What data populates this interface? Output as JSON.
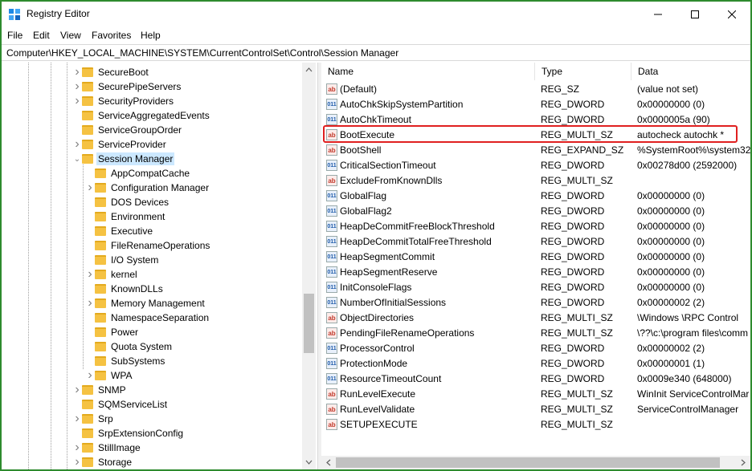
{
  "window": {
    "title": "Registry Editor"
  },
  "menu": [
    "File",
    "Edit",
    "View",
    "Favorites",
    "Help"
  ],
  "address": "Computer\\HKEY_LOCAL_MACHINE\\SYSTEM\\CurrentControlSet\\Control\\Session Manager",
  "tree": {
    "items": [
      {
        "label": "SecureBoot",
        "level": 1,
        "chev": ">"
      },
      {
        "label": "SecurePipeServers",
        "level": 1,
        "chev": ">"
      },
      {
        "label": "SecurityProviders",
        "level": 1,
        "chev": ">"
      },
      {
        "label": "ServiceAggregatedEvents",
        "level": 1,
        "chev": ""
      },
      {
        "label": "ServiceGroupOrder",
        "level": 1,
        "chev": ""
      },
      {
        "label": "ServiceProvider",
        "level": 1,
        "chev": ">"
      },
      {
        "label": "Session Manager",
        "level": 1,
        "chev": "v",
        "selected": true
      },
      {
        "label": "AppCompatCache",
        "level": 2,
        "chev": ""
      },
      {
        "label": "Configuration Manager",
        "level": 2,
        "chev": ">"
      },
      {
        "label": "DOS Devices",
        "level": 2,
        "chev": ""
      },
      {
        "label": "Environment",
        "level": 2,
        "chev": ""
      },
      {
        "label": "Executive",
        "level": 2,
        "chev": ""
      },
      {
        "label": "FileRenameOperations",
        "level": 2,
        "chev": ""
      },
      {
        "label": "I/O System",
        "level": 2,
        "chev": ""
      },
      {
        "label": "kernel",
        "level": 2,
        "chev": ">"
      },
      {
        "label": "KnownDLLs",
        "level": 2,
        "chev": ""
      },
      {
        "label": "Memory Management",
        "level": 2,
        "chev": ">"
      },
      {
        "label": "NamespaceSeparation",
        "level": 2,
        "chev": ""
      },
      {
        "label": "Power",
        "level": 2,
        "chev": ""
      },
      {
        "label": "Quota System",
        "level": 2,
        "chev": ""
      },
      {
        "label": "SubSystems",
        "level": 2,
        "chev": ""
      },
      {
        "label": "WPA",
        "level": 2,
        "chev": ">"
      },
      {
        "label": "SNMP",
        "level": 1,
        "chev": ">"
      },
      {
        "label": "SQMServiceList",
        "level": 1,
        "chev": ""
      },
      {
        "label": "Srp",
        "level": 1,
        "chev": ">"
      },
      {
        "label": "SrpExtensionConfig",
        "level": 1,
        "chev": ""
      },
      {
        "label": "StillImage",
        "level": 1,
        "chev": ">"
      },
      {
        "label": "Storage",
        "level": 1,
        "chev": ">"
      }
    ]
  },
  "columns": {
    "name": "Name",
    "type": "Type",
    "data": "Data"
  },
  "values": [
    {
      "name": "(Default)",
      "type": "REG_SZ",
      "data": "(value not set)",
      "icon": "ab"
    },
    {
      "name": "AutoChkSkipSystemPartition",
      "type": "REG_DWORD",
      "data": "0x00000000 (0)",
      "icon": "bin"
    },
    {
      "name": "AutoChkTimeout",
      "type": "REG_DWORD",
      "data": "0x0000005a (90)",
      "icon": "bin"
    },
    {
      "name": "BootExecute",
      "type": "REG_MULTI_SZ",
      "data": "autocheck autochk *",
      "icon": "ab"
    },
    {
      "name": "BootShell",
      "type": "REG_EXPAND_SZ",
      "data": "%SystemRoot%\\system32\\",
      "icon": "ab"
    },
    {
      "name": "CriticalSectionTimeout",
      "type": "REG_DWORD",
      "data": "0x00278d00 (2592000)",
      "icon": "bin"
    },
    {
      "name": "ExcludeFromKnownDlls",
      "type": "REG_MULTI_SZ",
      "data": "",
      "icon": "ab"
    },
    {
      "name": "GlobalFlag",
      "type": "REG_DWORD",
      "data": "0x00000000 (0)",
      "icon": "bin"
    },
    {
      "name": "GlobalFlag2",
      "type": "REG_DWORD",
      "data": "0x00000000 (0)",
      "icon": "bin"
    },
    {
      "name": "HeapDeCommitFreeBlockThreshold",
      "type": "REG_DWORD",
      "data": "0x00000000 (0)",
      "icon": "bin"
    },
    {
      "name": "HeapDeCommitTotalFreeThreshold",
      "type": "REG_DWORD",
      "data": "0x00000000 (0)",
      "icon": "bin"
    },
    {
      "name": "HeapSegmentCommit",
      "type": "REG_DWORD",
      "data": "0x00000000 (0)",
      "icon": "bin"
    },
    {
      "name": "HeapSegmentReserve",
      "type": "REG_DWORD",
      "data": "0x00000000 (0)",
      "icon": "bin"
    },
    {
      "name": "InitConsoleFlags",
      "type": "REG_DWORD",
      "data": "0x00000000 (0)",
      "icon": "bin"
    },
    {
      "name": "NumberOfInitialSessions",
      "type": "REG_DWORD",
      "data": "0x00000002 (2)",
      "icon": "bin"
    },
    {
      "name": "ObjectDirectories",
      "type": "REG_MULTI_SZ",
      "data": "\\Windows \\RPC Control",
      "icon": "ab"
    },
    {
      "name": "PendingFileRenameOperations",
      "type": "REG_MULTI_SZ",
      "data": "\\??\\c:\\program files\\comm",
      "icon": "ab"
    },
    {
      "name": "ProcessorControl",
      "type": "REG_DWORD",
      "data": "0x00000002 (2)",
      "icon": "bin"
    },
    {
      "name": "ProtectionMode",
      "type": "REG_DWORD",
      "data": "0x00000001 (1)",
      "icon": "bin"
    },
    {
      "name": "ResourceTimeoutCount",
      "type": "REG_DWORD",
      "data": "0x0009e340 (648000)",
      "icon": "bin"
    },
    {
      "name": "RunLevelExecute",
      "type": "REG_MULTI_SZ",
      "data": "WinInit ServiceControlMar",
      "icon": "ab"
    },
    {
      "name": "RunLevelValidate",
      "type": "REG_MULTI_SZ",
      "data": "ServiceControlManager",
      "icon": "ab"
    },
    {
      "name": "SETUPEXECUTE",
      "type": "REG_MULTI_SZ",
      "data": "",
      "icon": "ab"
    }
  ],
  "colors": {
    "frame": "#2e8b2e",
    "highlight": "#e02020",
    "selection": "#cce8ff",
    "folder": "#f5c242"
  }
}
